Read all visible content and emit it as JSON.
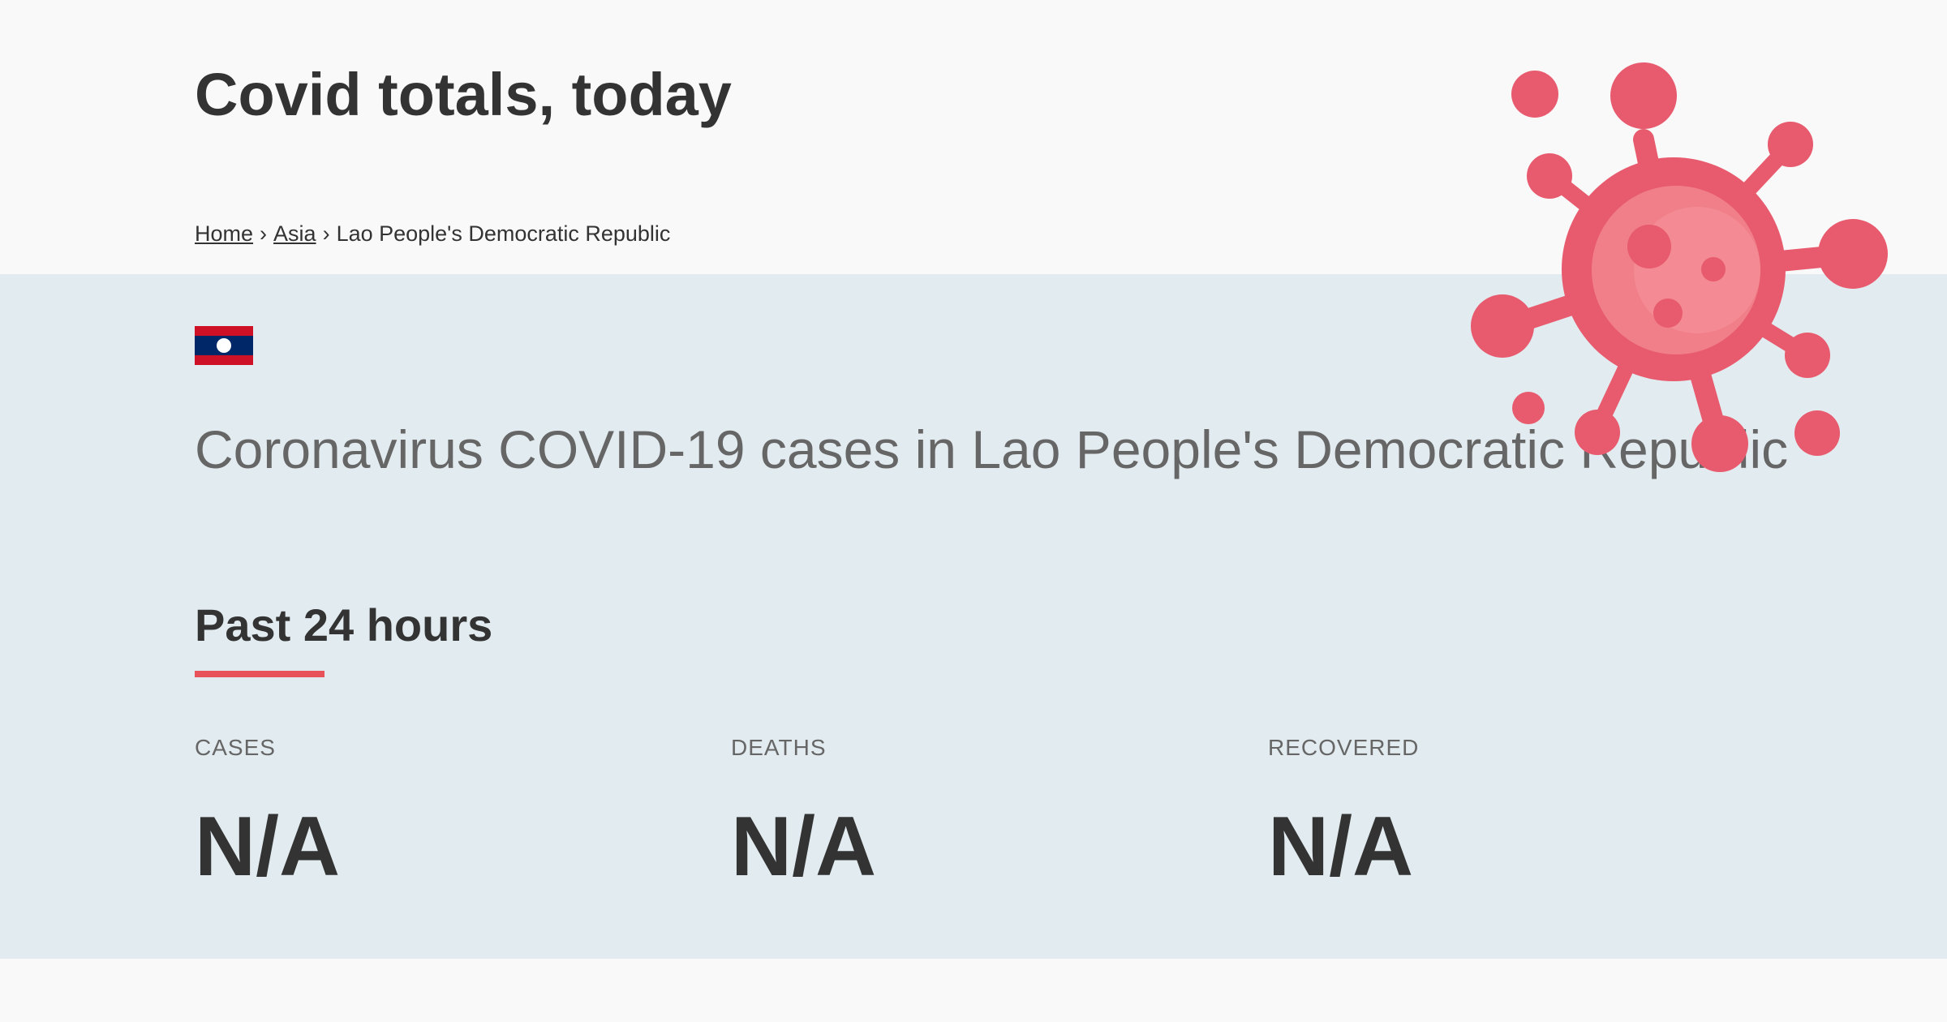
{
  "header": {
    "site_title": "Covid totals, today",
    "breadcrumb": {
      "home": "Home",
      "region": "Asia",
      "current": "Lao People's Democratic Republic",
      "separator": "›"
    }
  },
  "country": {
    "flag_icon": "laos-flag-icon",
    "heading": "Coronavirus COVID-19 cases in Lao People's Democratic Republic"
  },
  "period": {
    "title": "Past 24 hours"
  },
  "stats": [
    {
      "label": "CASES",
      "value": "N/A"
    },
    {
      "label": "DEATHS",
      "value": "N/A"
    },
    {
      "label": "RECOVERED",
      "value": "N/A"
    }
  ],
  "decoration": {
    "virus_icon": "coronavirus-icon"
  },
  "colors": {
    "accent": "#e8525a",
    "virus": "#e85a6d",
    "band_background": "#e2ebef",
    "page_background": "#f9f9f9"
  }
}
